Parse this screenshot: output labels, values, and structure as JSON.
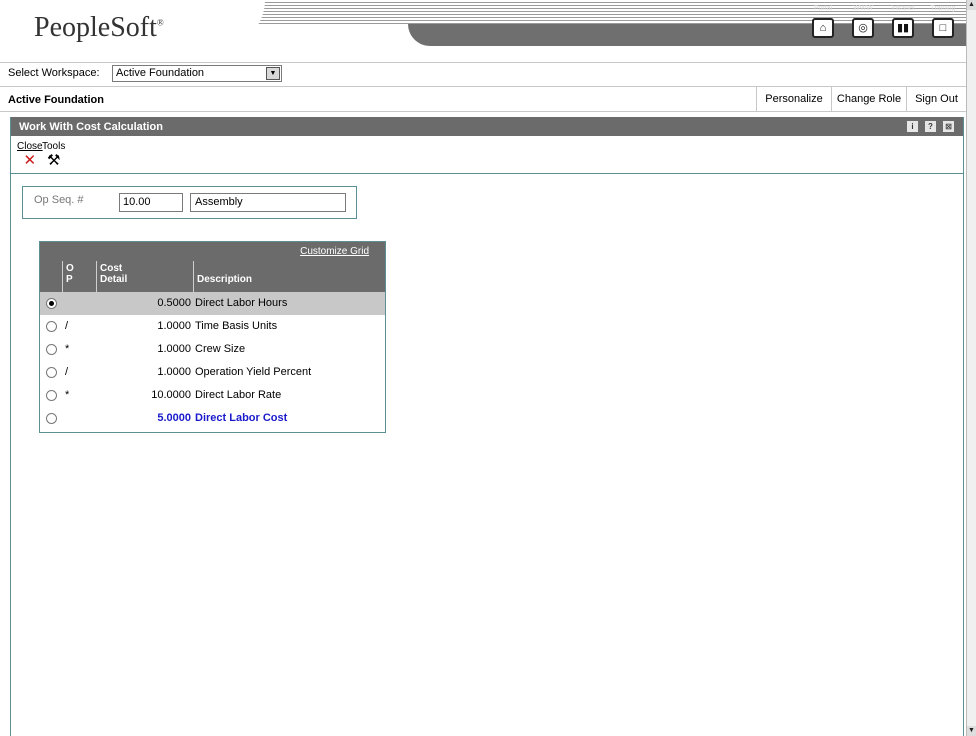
{
  "header": {
    "logo_text": "PeopleSoft",
    "logo_mark": "®",
    "nav": [
      {
        "label": "Portal",
        "icon": "home-icon",
        "glyph": "⌂"
      },
      {
        "label": "WWW",
        "icon": "globe-icon",
        "glyph": "◎"
      },
      {
        "label": "Intranet",
        "icon": "book-icon",
        "glyph": "▮▮"
      },
      {
        "label": "Training",
        "icon": "monitor-icon",
        "glyph": "□"
      }
    ]
  },
  "workspace": {
    "label": "Select Workspace:",
    "selected": "Active Foundation",
    "dropdown_glyph": "▼"
  },
  "titlebar": {
    "title": "Active Foundation",
    "personalize": "Personalize",
    "change_role": "Change Role",
    "sign_out": "Sign Out"
  },
  "form": {
    "title": "Work With Cost Calculation",
    "icons": {
      "info": "i",
      "help": "?",
      "max": "⊠"
    }
  },
  "toolbar": {
    "close_label": "Close",
    "close_glyph": "✕",
    "tools_label": "Tools",
    "tools_glyph": "⚒"
  },
  "opseq": {
    "label": "Op Seq. #",
    "value": "10.00",
    "description": "Assembly"
  },
  "grid": {
    "customize_label": "Customize Grid",
    "columns": {
      "op": "O\nP",
      "op_line1": "O",
      "op_line2": "P",
      "cost_line1": "Cost",
      "cost_line2": "Detail",
      "description": "Description"
    },
    "rows": [
      {
        "op": "",
        "cost": "0.5000",
        "description": "Direct Labor Hours",
        "selected": true
      },
      {
        "op": "/",
        "cost": "1.0000",
        "description": "Time Basis Units"
      },
      {
        "op": "*",
        "cost": "1.0000",
        "description": "Crew Size"
      },
      {
        "op": "/",
        "cost": "1.0000",
        "description": "Operation Yield Percent"
      },
      {
        "op": "*",
        "cost": "10.0000",
        "description": "Direct Labor Rate"
      },
      {
        "op": "",
        "cost": "5.0000",
        "description": "Direct Labor Cost",
        "total": true
      }
    ]
  },
  "colors": {
    "frame_teal": "#5a8f93",
    "header_gray": "#6b6b6b",
    "total_blue": "#1a1acc",
    "close_red": "#cc1a1a"
  }
}
